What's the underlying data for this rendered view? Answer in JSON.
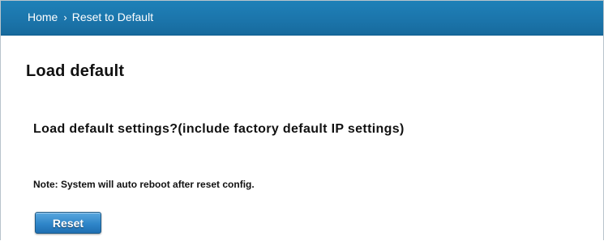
{
  "breadcrumb": {
    "home_label": "Home",
    "separator": "›",
    "current_label": "Reset to Default"
  },
  "main": {
    "title": "Load default",
    "question": "Load default settings?(include factory default IP settings)",
    "note": "Note: System will auto reboot after reset config.",
    "reset_button_label": "Reset"
  },
  "colors": {
    "topbar": "#1b74aa",
    "button": "#2f86c9",
    "text": "#111111"
  }
}
